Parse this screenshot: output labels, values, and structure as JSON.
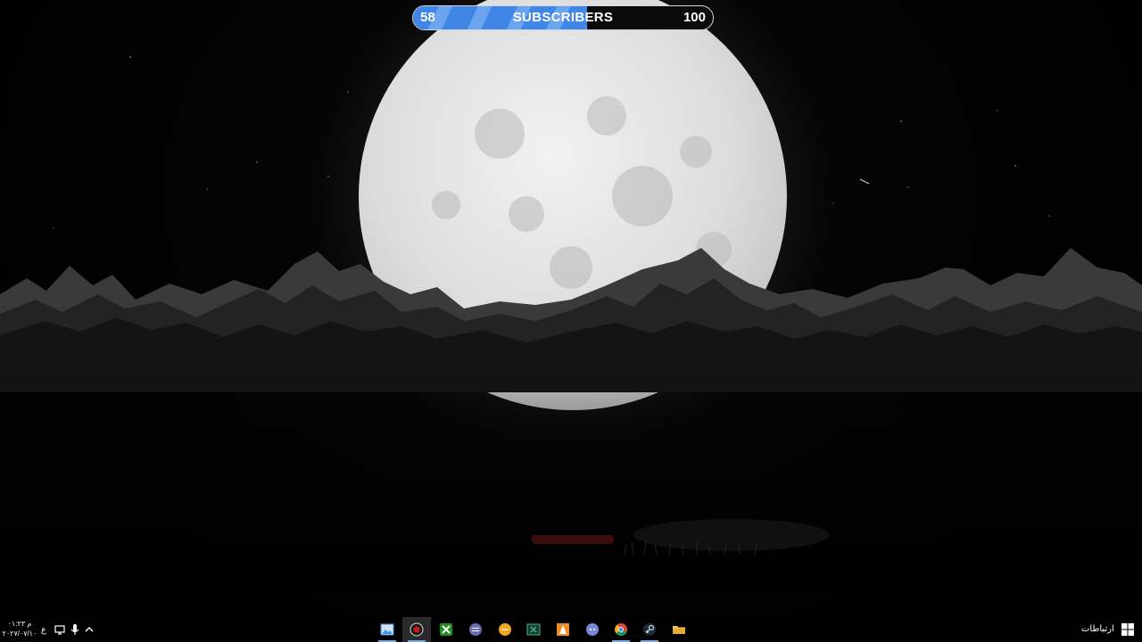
{
  "subscriber_widget": {
    "current": "58",
    "label": "SUBSCRIBERS",
    "goal": "100",
    "progress_fraction": 0.58,
    "fill_color": "#3f86e6",
    "border_color": "#cfd8e6"
  },
  "wallpaper": {
    "moon_color": "#e6e6e6",
    "mountain_color": "#3a3a3a",
    "sky_color": "#000000"
  },
  "taskbar": {
    "start_icon": "windows-logo-icon",
    "network_label": "ارتباطات",
    "apps": [
      {
        "icon": "photos-app-icon"
      },
      {
        "icon": "obs-record-icon"
      },
      {
        "icon": "xbox-icon"
      },
      {
        "icon": "media-app-icon"
      },
      {
        "icon": "chat-bubble-icon"
      },
      {
        "icon": "excel-like-icon"
      },
      {
        "icon": "vlc-cone-icon"
      },
      {
        "icon": "discord-like-icon"
      },
      {
        "icon": "chrome-icon"
      },
      {
        "icon": "steam-icon"
      },
      {
        "icon": "file-explorer-icon"
      }
    ],
    "tray": {
      "chevron_icon": "chevron-up-icon",
      "mic_icon": "microphone-icon",
      "network_icon": "network-icon",
      "language": "ع",
      "time": "۰۱:۲۳ م",
      "date": "۲۰۲۷/۰۷/۱۰"
    }
  }
}
